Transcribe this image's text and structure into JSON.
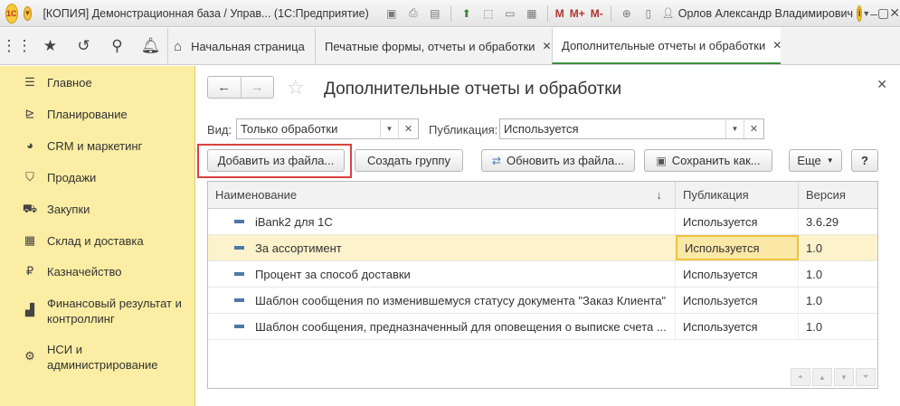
{
  "window": {
    "title": "[КОПИЯ] Демонстрационная база / Управ... (1С:Предприятие)",
    "user": "Орлов Александр Владимирович",
    "toolbar_m": [
      "M",
      "M+",
      "M-"
    ]
  },
  "tabs": [
    {
      "label": "Начальная страница"
    },
    {
      "label": "Печатные формы, отчеты и обработки"
    },
    {
      "label": "Дополнительные отчеты и обработки"
    }
  ],
  "sidebar": {
    "items": [
      {
        "label": "Главное",
        "icon": "menu-icon"
      },
      {
        "label": "Планирование",
        "icon": "planning-icon"
      },
      {
        "label": "CRM и маркетинг",
        "icon": "crm-icon"
      },
      {
        "label": "Продажи",
        "icon": "cart-icon"
      },
      {
        "label": "Закупки",
        "icon": "truck-icon"
      },
      {
        "label": "Склад и доставка",
        "icon": "warehouse-icon"
      },
      {
        "label": "Казначейство",
        "icon": "ruble-icon"
      },
      {
        "label": "Финансовый результат и контроллинг",
        "icon": "chart-icon"
      },
      {
        "label": "НСИ и администрирование",
        "icon": "gear-icon"
      }
    ]
  },
  "page": {
    "title": "Дополнительные отчеты и обработки",
    "filters": {
      "vid_label": "Вид:",
      "vid_value": "Только обработки",
      "pub_label": "Публикация:",
      "pub_value": "Используется"
    },
    "buttons": {
      "add_from_file": "Добавить из файла...",
      "create_group": "Создать группу",
      "update_from_file": "Обновить из файла...",
      "save_as": "Сохранить как...",
      "more": "Еще",
      "help": "?"
    },
    "table": {
      "columns": [
        "Наименование",
        "Публикация",
        "Версия"
      ],
      "rows": [
        {
          "name": "iBank2 для 1С",
          "pub": "Используется",
          "ver": "3.6.29"
        },
        {
          "name": "За ассортимент",
          "pub": "Используется",
          "ver": "1.0"
        },
        {
          "name": "Процент за способ доставки",
          "pub": "Используется",
          "ver": "1.0"
        },
        {
          "name": "Шаблон сообщения по изменившемуся статусу документа \"Заказ Клиента\"",
          "pub": "Используется",
          "ver": "1.0"
        },
        {
          "name": "Шаблон сообщения, предназначенный для оповещения о выписке счета ...",
          "pub": "Используется",
          "ver": "1.0"
        }
      ]
    }
  },
  "colors": {
    "sidebar_bg": "#fbeda3",
    "accent_green": "#3d8f3f",
    "highlight_red": "#d9413d",
    "selection": "#fcf2cc"
  }
}
